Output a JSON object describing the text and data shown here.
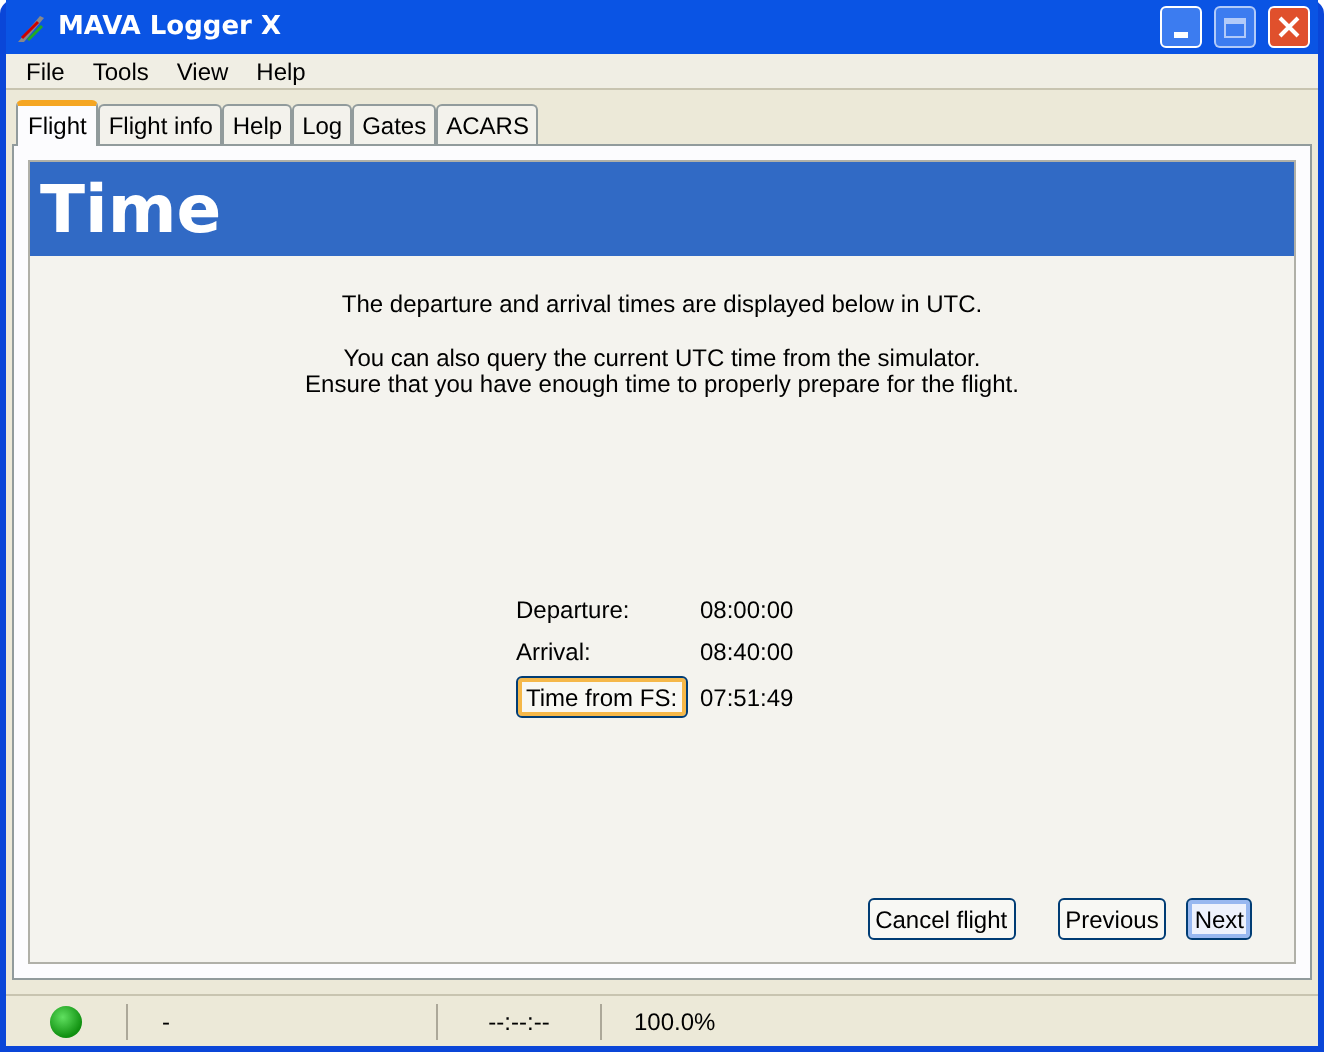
{
  "window": {
    "title": "MAVA Logger X"
  },
  "menu": [
    "File",
    "Tools",
    "View",
    "Help"
  ],
  "tabs": [
    {
      "label": "Flight",
      "selected": true
    },
    {
      "label": "Flight info",
      "selected": false
    },
    {
      "label": "Help",
      "selected": false
    },
    {
      "label": "Log",
      "selected": false
    },
    {
      "label": "Gates",
      "selected": false
    },
    {
      "label": "ACARS",
      "selected": false
    }
  ],
  "page": {
    "heading": "Time",
    "intro": "The departure and arrival times are displayed below in UTC.",
    "notes": [
      "You can also query the current UTC time from the simulator.",
      "Ensure that you have enough time to properly prepare for the flight."
    ]
  },
  "times": [
    {
      "kind": "label",
      "label": "Departure:",
      "value": "08:00:00"
    },
    {
      "kind": "label",
      "label": "Arrival:",
      "value": "08:40:00"
    },
    {
      "kind": "button",
      "label": "Time from FS:",
      "value": "07:51:49",
      "focused": true
    }
  ],
  "buttons": [
    {
      "label": "Cancel flight",
      "default": false
    },
    {
      "label": "Previous",
      "default": false
    },
    {
      "label": "Next",
      "default": true
    }
  ],
  "status_bar": {
    "connected": true,
    "field_1": "-",
    "time": "--:--:--",
    "rate": "100.0%"
  }
}
